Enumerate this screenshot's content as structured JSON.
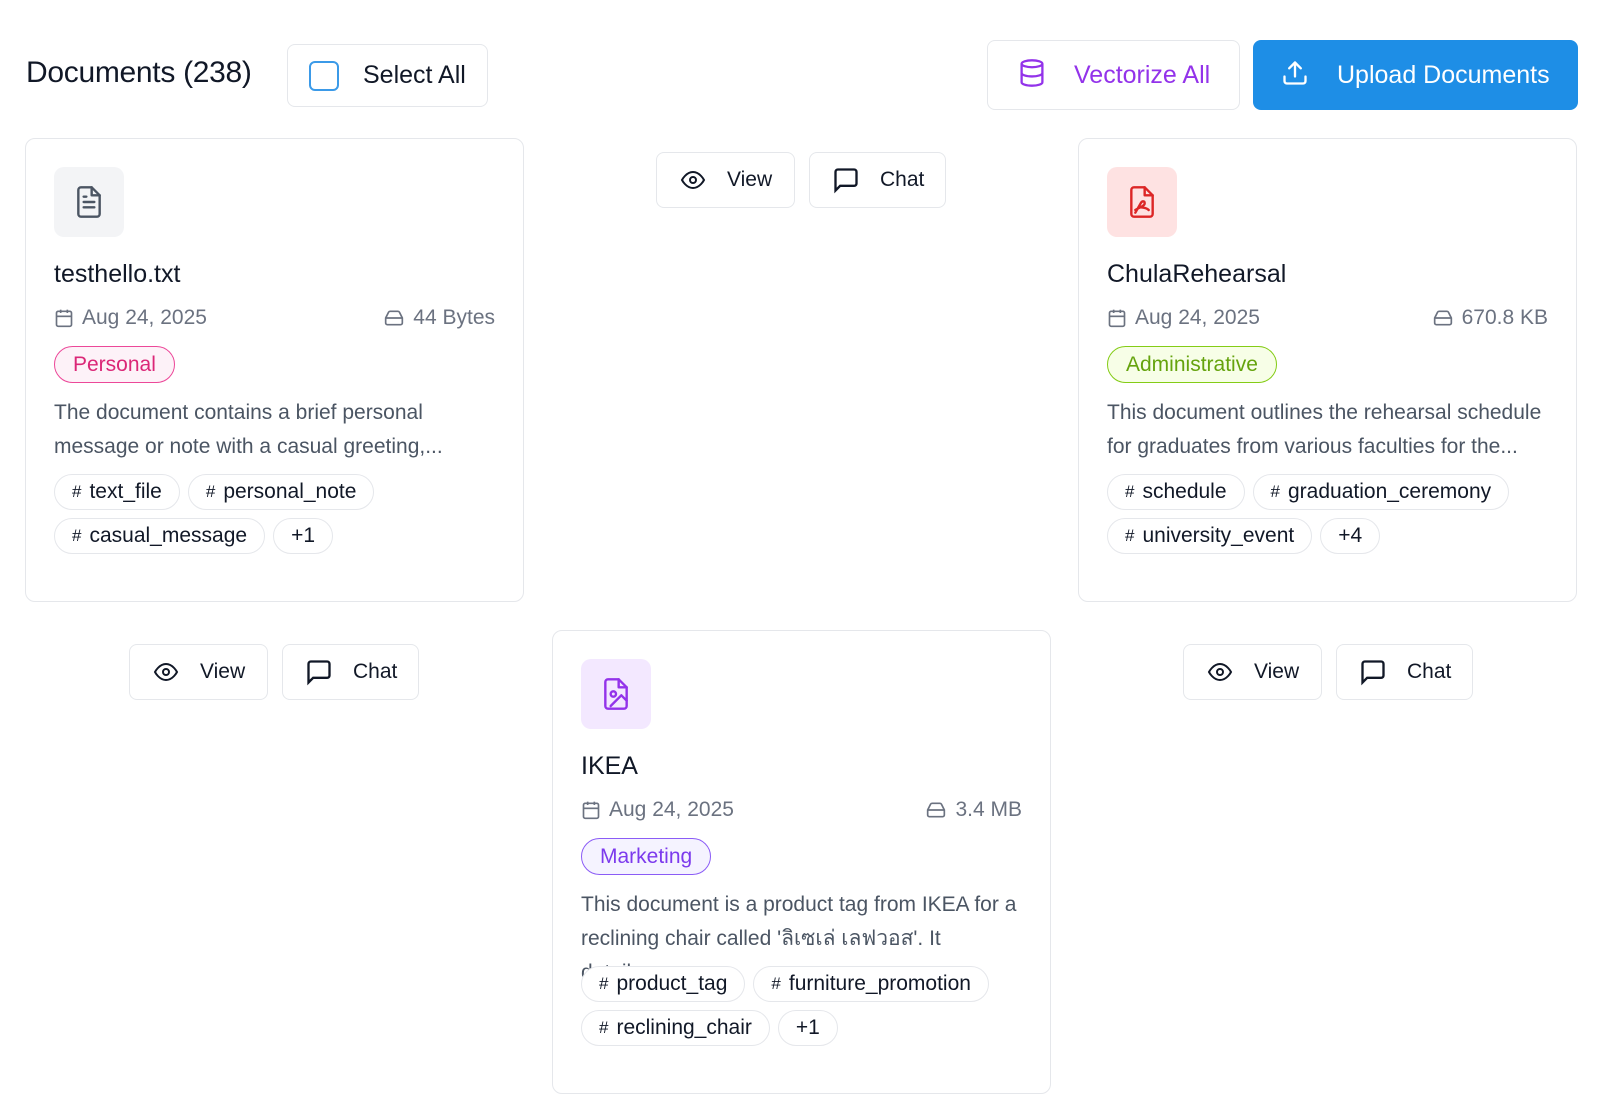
{
  "header": {
    "title": "Documents (238)",
    "select_all_label": "Select All",
    "vectorize_all_label": "Vectorize All",
    "upload_label": "Upload Documents"
  },
  "actions": {
    "view_label": "View",
    "chat_label": "Chat"
  },
  "colors": {
    "primary": "#1e8ee6",
    "vectorize": "#9333ea",
    "personal": "#db2777",
    "administrative": "#65a30d",
    "marketing": "#7c3aed"
  },
  "documents": [
    {
      "icon": "text-file-icon",
      "name": "testhello.txt",
      "date": "Aug 24, 2025",
      "size": "44 Bytes",
      "category": "Personal",
      "description_line1": "The document contains a brief personal",
      "description_line2": "message or note with a casual greeting,...",
      "tags": [
        "text_file",
        "personal_note",
        "casual_message"
      ],
      "more": "+1"
    },
    {
      "icon": "pdf-file-icon",
      "name": "ChulaRehearsal",
      "date": "Aug 24, 2025",
      "size": "670.8 KB",
      "category": "Administrative",
      "description_line1": "This document outlines the rehearsal schedule",
      "description_line2": "for graduates from various faculties for the...",
      "tags": [
        "schedule",
        "graduation_ceremony",
        "university_event"
      ],
      "more": "+4"
    },
    {
      "icon": "image-file-icon",
      "name": "IKEA",
      "date": "Aug 24, 2025",
      "size": "3.4 MB",
      "category": "Marketing",
      "description_line1": "This document is a product tag from IKEA for a",
      "description_line2": "reclining chair called 'ลิเซเล่ เลฟวอส'. It details...",
      "tags": [
        "product_tag",
        "furniture_promotion",
        "reclining_chair"
      ],
      "more": "+1"
    }
  ]
}
